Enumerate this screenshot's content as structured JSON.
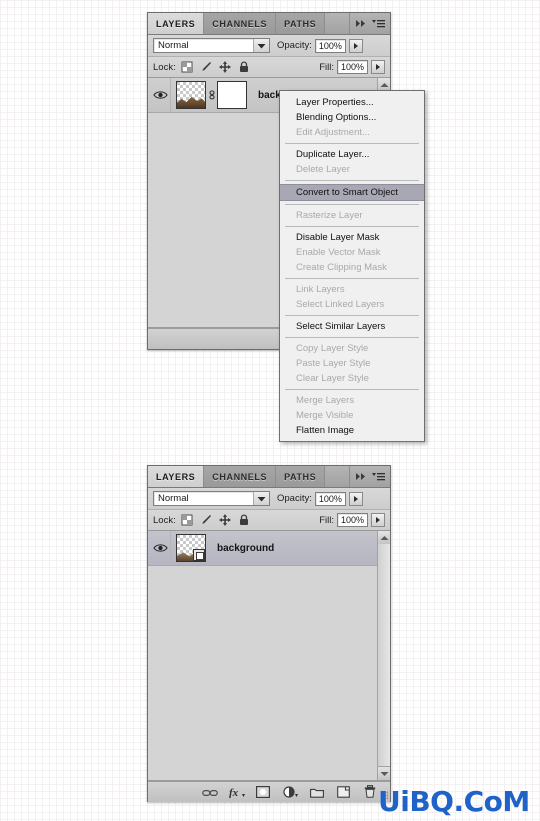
{
  "panels": [
    {
      "id": "top",
      "tabs": [
        {
          "label": "LAYERS",
          "active": true
        },
        {
          "label": "CHANNELS",
          "active": false
        },
        {
          "label": "PATHS",
          "active": false
        }
      ],
      "controls": {
        "blend_mode": "Normal",
        "opacity_label": "Opacity:",
        "opacity_value": "100%",
        "fill_label": "Fill:",
        "fill_value": "100%",
        "lock_label": "Lock:"
      },
      "layer": {
        "name": "background",
        "selected": false,
        "has_mask": true,
        "smart_object": false
      },
      "footer_icons": [
        "link-icon",
        "fx-icon",
        "add-mask-icon"
      ]
    },
    {
      "id": "bottom",
      "tabs": [
        {
          "label": "LAYERS",
          "active": true
        },
        {
          "label": "CHANNELS",
          "active": false
        },
        {
          "label": "PATHS",
          "active": false
        }
      ],
      "controls": {
        "blend_mode": "Normal",
        "opacity_label": "Opacity:",
        "opacity_value": "100%",
        "fill_label": "Fill:",
        "fill_value": "100%",
        "lock_label": "Lock:"
      },
      "layer": {
        "name": "background",
        "selected": true,
        "has_mask": false,
        "smart_object": true
      },
      "footer_icons": [
        "link-icon",
        "fx-icon",
        "add-mask-icon",
        "adjustment-icon",
        "new-group-icon",
        "new-layer-icon",
        "delete-layer-icon"
      ]
    }
  ],
  "context_menu": {
    "items": [
      {
        "label": "Layer Properties...",
        "state": "enabled"
      },
      {
        "label": "Blending Options...",
        "state": "enabled"
      },
      {
        "label": "Edit Adjustment...",
        "state": "disabled"
      },
      {
        "separator": true
      },
      {
        "label": "Duplicate Layer...",
        "state": "enabled"
      },
      {
        "label": "Delete Layer",
        "state": "disabled"
      },
      {
        "separator": true
      },
      {
        "label": "Convert to Smart Object",
        "state": "highlight"
      },
      {
        "separator": true
      },
      {
        "label": "Rasterize Layer",
        "state": "disabled"
      },
      {
        "separator": true
      },
      {
        "label": "Disable Layer Mask",
        "state": "enabled"
      },
      {
        "label": "Enable Vector Mask",
        "state": "disabled"
      },
      {
        "label": "Create Clipping Mask",
        "state": "disabled"
      },
      {
        "separator": true
      },
      {
        "label": "Link Layers",
        "state": "disabled"
      },
      {
        "label": "Select Linked Layers",
        "state": "disabled"
      },
      {
        "separator": true
      },
      {
        "label": "Select Similar Layers",
        "state": "enabled"
      },
      {
        "separator": true
      },
      {
        "label": "Copy Layer Style",
        "state": "disabled"
      },
      {
        "label": "Paste Layer Style",
        "state": "disabled"
      },
      {
        "label": "Clear Layer Style",
        "state": "disabled"
      },
      {
        "separator": true
      },
      {
        "label": "Merge Layers",
        "state": "disabled"
      },
      {
        "label": "Merge Visible",
        "state": "disabled"
      },
      {
        "label": "Flatten Image",
        "state": "enabled"
      }
    ]
  },
  "watermark": {
    "text": "UiBQ.CoM",
    "color": "#1f62c8"
  },
  "colors": {
    "panel_bg": "#d5d5d5",
    "tab_active": "#dcdcdc",
    "menu_bg": "#f0f0f0",
    "menu_highlight": "#a8a8b4",
    "layer_selected": "#c3c3cc",
    "disabled_text": "#a9a9a9"
  }
}
